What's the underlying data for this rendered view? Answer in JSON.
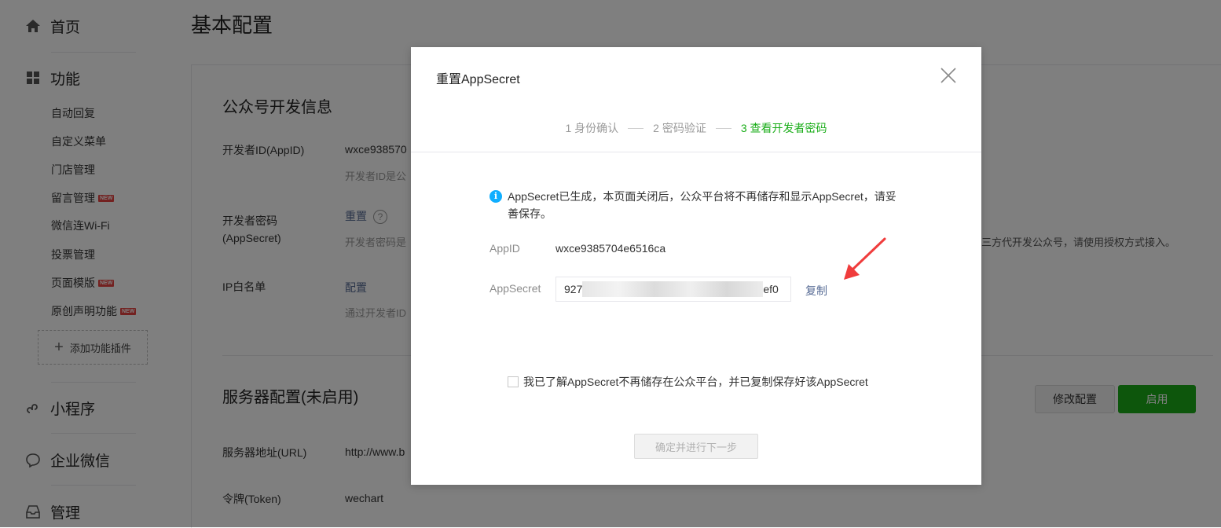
{
  "sidebar": {
    "home": "首页",
    "features": "功能",
    "sub_items": [
      {
        "label": "自动回复",
        "badge": ""
      },
      {
        "label": "自定义菜单",
        "badge": ""
      },
      {
        "label": "门店管理",
        "badge": ""
      },
      {
        "label": "留言管理",
        "badge": "NEW"
      },
      {
        "label": "微信连Wi-Fi",
        "badge": ""
      },
      {
        "label": "投票管理",
        "badge": ""
      },
      {
        "label": "页面模版",
        "badge": "NEW"
      },
      {
        "label": "原创声明功能",
        "badge": "NEW"
      }
    ],
    "add_plugin": "添加功能插件",
    "mini_program": "小程序",
    "enterprise_wechat": "企业微信",
    "manage": "管理"
  },
  "page": {
    "title": "基本配置",
    "dev_info_title": "公众号开发信息",
    "appid_label": "开发者ID(AppID)",
    "appid_value": "wxce938570",
    "appid_desc": "开发者ID是公",
    "secret_label_1": "开发者密码",
    "secret_label_2": "(AppSecret)",
    "secret_link": "重置",
    "secret_desc": "开发者密码是",
    "secret_desc_tail": "三方代开发公众号，请使用授权方式接入。",
    "ip_label": "IP白名单",
    "ip_link": "配置",
    "ip_desc": "通过开发者ID",
    "server_title": "服务器配置(未启用)",
    "modify_button": "修改配置",
    "enable_button": "启用",
    "url_label": "服务器地址(URL)",
    "url_value": "http://www.b",
    "token_label": "令牌(Token)",
    "token_value": "wechart"
  },
  "dialog": {
    "title": "重置AppSecret",
    "steps": [
      "1 身份确认",
      "2 密码验证",
      "3 查看开发者密码"
    ],
    "active_step": 2,
    "notice": "AppSecret已生成，本页面关闭后，公众平台将不再储存和显示AppSecret，请妥善保存。",
    "appid_label": "AppID",
    "appid_value": "wxce9385704e6516ca",
    "secret_label": "AppSecret",
    "secret_prefix": "927",
    "secret_suffix": "ef0",
    "copy_label": "复制",
    "agree_text": "我已了解AppSecret不再储存在公众平台，并已复制保存好该AppSecret",
    "next_button": "确定并进行下一步"
  },
  "colors": {
    "brand_green": "#1aad19",
    "link_blue": "#576b95",
    "info_blue": "#10aeff",
    "arrow_red": "#f03c3c"
  }
}
